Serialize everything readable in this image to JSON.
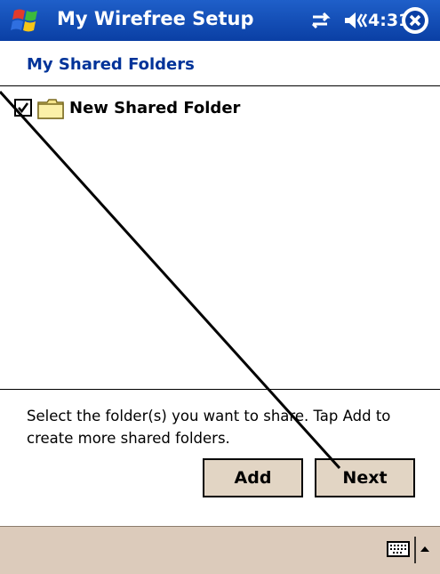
{
  "titlebar": {
    "app_title": "My Wirefree Setup",
    "clock": "4:31",
    "color": "#0a3fa4"
  },
  "section": {
    "title": "My Shared Folders",
    "color": "#003399"
  },
  "list": {
    "items": [
      {
        "label": "New Shared Folder",
        "checked": true
      }
    ]
  },
  "instructions": "Select the folder(s) you want to share.  Tap Add to create more shared folders.",
  "buttons": {
    "add_label": "Add",
    "next_label": "Next"
  },
  "icons": [
    "windows-start-icon",
    "connectivity-icon",
    "volume-icon",
    "close-icon",
    "checkbox-icon",
    "folder-icon",
    "keyboard-icon",
    "sip-arrow-icon"
  ]
}
